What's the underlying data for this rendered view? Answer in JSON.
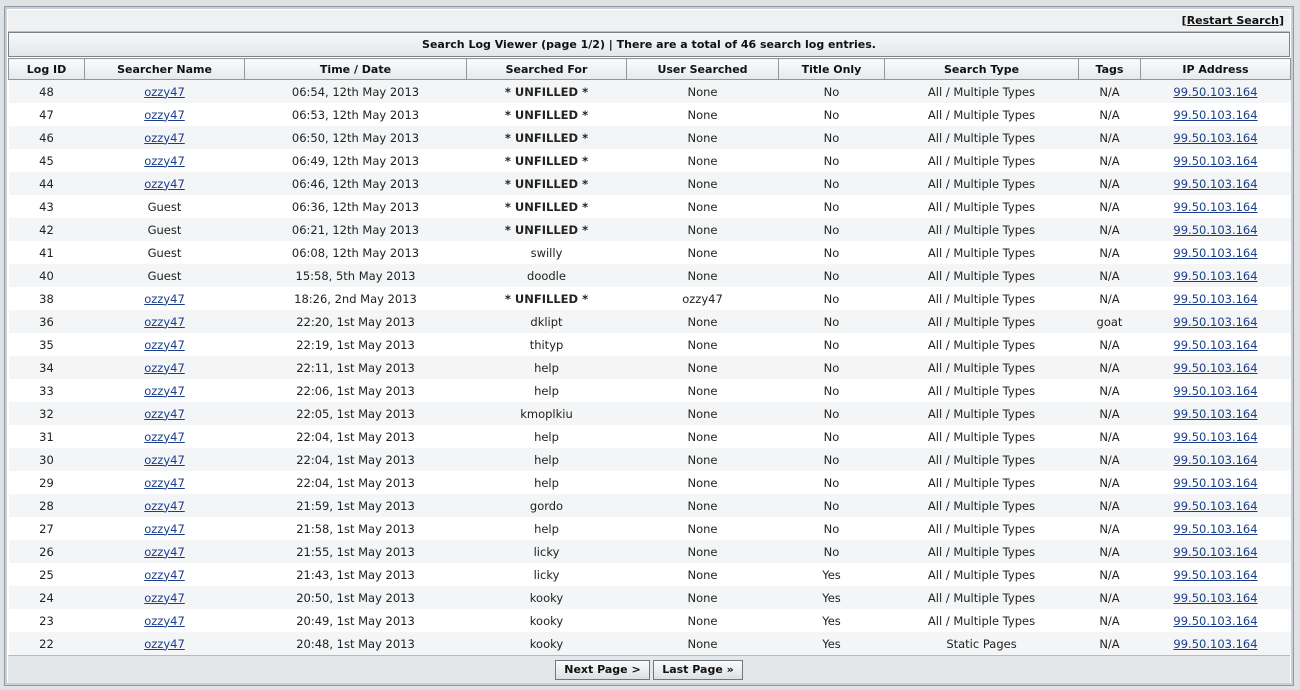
{
  "header": {
    "restart_prefix": "[",
    "restart_label": "Restart Search",
    "restart_suffix": "]",
    "title": "Search Log Viewer (page 1/2) | There are a total of 46 search log entries."
  },
  "columns": [
    "Log ID",
    "Searcher Name",
    "Time / Date",
    "Searched For",
    "User Searched",
    "Title Only",
    "Search Type",
    "Tags",
    "IP Address"
  ],
  "rows": [
    {
      "id": "48",
      "name": "ozzy47",
      "linked": true,
      "time": "06:54, 12th May 2013",
      "query": "* UNFILLED *",
      "unfilled": true,
      "user": "None",
      "title_only": "No",
      "type": "All / Multiple Types",
      "tags": "N/A",
      "ip": "99.50.103.164"
    },
    {
      "id": "47",
      "name": "ozzy47",
      "linked": true,
      "time": "06:53, 12th May 2013",
      "query": "* UNFILLED *",
      "unfilled": true,
      "user": "None",
      "title_only": "No",
      "type": "All / Multiple Types",
      "tags": "N/A",
      "ip": "99.50.103.164"
    },
    {
      "id": "46",
      "name": "ozzy47",
      "linked": true,
      "time": "06:50, 12th May 2013",
      "query": "* UNFILLED *",
      "unfilled": true,
      "user": "None",
      "title_only": "No",
      "type": "All / Multiple Types",
      "tags": "N/A",
      "ip": "99.50.103.164"
    },
    {
      "id": "45",
      "name": "ozzy47",
      "linked": true,
      "time": "06:49, 12th May 2013",
      "query": "* UNFILLED *",
      "unfilled": true,
      "user": "None",
      "title_only": "No",
      "type": "All / Multiple Types",
      "tags": "N/A",
      "ip": "99.50.103.164"
    },
    {
      "id": "44",
      "name": "ozzy47",
      "linked": true,
      "time": "06:46, 12th May 2013",
      "query": "* UNFILLED *",
      "unfilled": true,
      "user": "None",
      "title_only": "No",
      "type": "All / Multiple Types",
      "tags": "N/A",
      "ip": "99.50.103.164"
    },
    {
      "id": "43",
      "name": "Guest",
      "linked": false,
      "time": "06:36, 12th May 2013",
      "query": "* UNFILLED *",
      "unfilled": true,
      "user": "None",
      "title_only": "No",
      "type": "All / Multiple Types",
      "tags": "N/A",
      "ip": "99.50.103.164"
    },
    {
      "id": "42",
      "name": "Guest",
      "linked": false,
      "time": "06:21, 12th May 2013",
      "query": "* UNFILLED *",
      "unfilled": true,
      "user": "None",
      "title_only": "No",
      "type": "All / Multiple Types",
      "tags": "N/A",
      "ip": "99.50.103.164"
    },
    {
      "id": "41",
      "name": "Guest",
      "linked": false,
      "time": "06:08, 12th May 2013",
      "query": "swilly",
      "unfilled": false,
      "user": "None",
      "title_only": "No",
      "type": "All / Multiple Types",
      "tags": "N/A",
      "ip": "99.50.103.164"
    },
    {
      "id": "40",
      "name": "Guest",
      "linked": false,
      "time": "15:58, 5th May 2013",
      "query": "doodle",
      "unfilled": false,
      "user": "None",
      "title_only": "No",
      "type": "All / Multiple Types",
      "tags": "N/A",
      "ip": "99.50.103.164"
    },
    {
      "id": "38",
      "name": "ozzy47",
      "linked": true,
      "time": "18:26, 2nd May 2013",
      "query": "* UNFILLED *",
      "unfilled": true,
      "user": "ozzy47",
      "title_only": "No",
      "type": "All / Multiple Types",
      "tags": "N/A",
      "ip": "99.50.103.164"
    },
    {
      "id": "36",
      "name": "ozzy47",
      "linked": true,
      "time": "22:20, 1st May 2013",
      "query": "dklipt",
      "unfilled": false,
      "user": "None",
      "title_only": "No",
      "type": "All / Multiple Types",
      "tags": "goat",
      "ip": "99.50.103.164"
    },
    {
      "id": "35",
      "name": "ozzy47",
      "linked": true,
      "time": "22:19, 1st May 2013",
      "query": "thityp",
      "unfilled": false,
      "user": "None",
      "title_only": "No",
      "type": "All / Multiple Types",
      "tags": "N/A",
      "ip": "99.50.103.164"
    },
    {
      "id": "34",
      "name": "ozzy47",
      "linked": true,
      "time": "22:11, 1st May 2013",
      "query": "help",
      "unfilled": false,
      "user": "None",
      "title_only": "No",
      "type": "All / Multiple Types",
      "tags": "N/A",
      "ip": "99.50.103.164"
    },
    {
      "id": "33",
      "name": "ozzy47",
      "linked": true,
      "time": "22:06, 1st May 2013",
      "query": "help",
      "unfilled": false,
      "user": "None",
      "title_only": "No",
      "type": "All / Multiple Types",
      "tags": "N/A",
      "ip": "99.50.103.164"
    },
    {
      "id": "32",
      "name": "ozzy47",
      "linked": true,
      "time": "22:05, 1st May 2013",
      "query": "kmoplkiu",
      "unfilled": false,
      "user": "None",
      "title_only": "No",
      "type": "All / Multiple Types",
      "tags": "N/A",
      "ip": "99.50.103.164"
    },
    {
      "id": "31",
      "name": "ozzy47",
      "linked": true,
      "time": "22:04, 1st May 2013",
      "query": "help",
      "unfilled": false,
      "user": "None",
      "title_only": "No",
      "type": "All / Multiple Types",
      "tags": "N/A",
      "ip": "99.50.103.164"
    },
    {
      "id": "30",
      "name": "ozzy47",
      "linked": true,
      "time": "22:04, 1st May 2013",
      "query": "help",
      "unfilled": false,
      "user": "None",
      "title_only": "No",
      "type": "All / Multiple Types",
      "tags": "N/A",
      "ip": "99.50.103.164"
    },
    {
      "id": "29",
      "name": "ozzy47",
      "linked": true,
      "time": "22:04, 1st May 2013",
      "query": "help",
      "unfilled": false,
      "user": "None",
      "title_only": "No",
      "type": "All / Multiple Types",
      "tags": "N/A",
      "ip": "99.50.103.164"
    },
    {
      "id": "28",
      "name": "ozzy47",
      "linked": true,
      "time": "21:59, 1st May 2013",
      "query": "gordo",
      "unfilled": false,
      "user": "None",
      "title_only": "No",
      "type": "All / Multiple Types",
      "tags": "N/A",
      "ip": "99.50.103.164"
    },
    {
      "id": "27",
      "name": "ozzy47",
      "linked": true,
      "time": "21:58, 1st May 2013",
      "query": "help",
      "unfilled": false,
      "user": "None",
      "title_only": "No",
      "type": "All / Multiple Types",
      "tags": "N/A",
      "ip": "99.50.103.164"
    },
    {
      "id": "26",
      "name": "ozzy47",
      "linked": true,
      "time": "21:55, 1st May 2013",
      "query": "licky",
      "unfilled": false,
      "user": "None",
      "title_only": "No",
      "type": "All / Multiple Types",
      "tags": "N/A",
      "ip": "99.50.103.164"
    },
    {
      "id": "25",
      "name": "ozzy47",
      "linked": true,
      "time": "21:43, 1st May 2013",
      "query": "licky",
      "unfilled": false,
      "user": "None",
      "title_only": "Yes",
      "type": "All / Multiple Types",
      "tags": "N/A",
      "ip": "99.50.103.164"
    },
    {
      "id": "24",
      "name": "ozzy47",
      "linked": true,
      "time": "20:50, 1st May 2013",
      "query": "kooky",
      "unfilled": false,
      "user": "None",
      "title_only": "Yes",
      "type": "All / Multiple Types",
      "tags": "N/A",
      "ip": "99.50.103.164"
    },
    {
      "id": "23",
      "name": "ozzy47",
      "linked": true,
      "time": "20:49, 1st May 2013",
      "query": "kooky",
      "unfilled": false,
      "user": "None",
      "title_only": "Yes",
      "type": "All / Multiple Types",
      "tags": "N/A",
      "ip": "99.50.103.164"
    },
    {
      "id": "22",
      "name": "ozzy47",
      "linked": true,
      "time": "20:48, 1st May 2013",
      "query": "kooky",
      "unfilled": false,
      "user": "None",
      "title_only": "Yes",
      "type": "Static Pages",
      "tags": "N/A",
      "ip": "99.50.103.164"
    }
  ],
  "pager": {
    "next_label": "Next Page >",
    "last_label": "Last Page »"
  }
}
